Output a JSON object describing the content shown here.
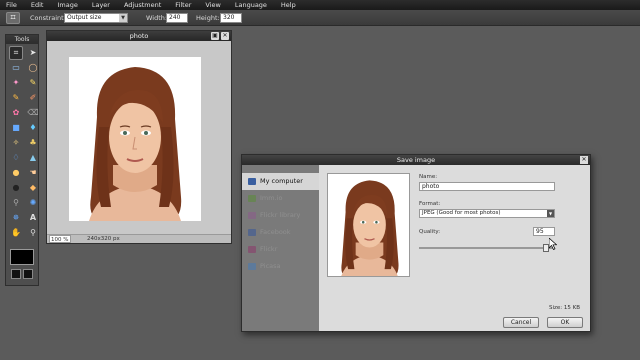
{
  "menu": [
    "File",
    "Edit",
    "Image",
    "Layer",
    "Adjustment",
    "Filter",
    "View",
    "Language",
    "Help"
  ],
  "options": {
    "constraint_label": "Constraint:",
    "constraint_value": "Output size",
    "width_label": "Width:",
    "width_value": "240",
    "height_label": "Height:",
    "height_value": "320"
  },
  "tools": {
    "title": "Tools",
    "icons": [
      "crop-icon",
      "move-icon",
      "marquee-icon",
      "lasso-icon",
      "wand-icon",
      "pencil-icon",
      "pencil2-icon",
      "brush-icon",
      "clone-icon",
      "eraser-icon",
      "gradient-icon",
      "bucket-icon",
      "replace-icon",
      "stamp-icon",
      "drop-icon",
      "sharpen-icon",
      "burn-icon",
      "smudge-icon",
      "redeye-icon",
      "sponge-icon",
      "eyedropper-icon",
      "bloat-icon",
      "pinch-icon",
      "text-icon",
      "hand-icon",
      "zoom-icon"
    ]
  },
  "photo_window": {
    "title": "photo",
    "zoom": "100 %",
    "dimensions": "240x320 px"
  },
  "save_dialog": {
    "title": "Save image",
    "destinations": [
      {
        "label": "My computer",
        "icon": "computer-icon",
        "selected": true,
        "color": "#3a5fa0"
      },
      {
        "label": "Imm.io",
        "icon": "immio-icon",
        "selected": false,
        "color": "#5c8a3c"
      },
      {
        "label": "Flickr library",
        "icon": "flickr-icon",
        "selected": false,
        "color": "#8a5c8a"
      },
      {
        "label": "Facebook",
        "icon": "facebook-icon",
        "selected": false,
        "color": "#3b5998"
      },
      {
        "label": "Flickr",
        "icon": "flickr2-icon",
        "selected": false,
        "color": "#8a3c6a"
      },
      {
        "label": "Picasa",
        "icon": "picasa-icon",
        "selected": false,
        "color": "#4a7ab0"
      }
    ],
    "name_label": "Name:",
    "name_value": "photo",
    "format_label": "Format:",
    "format_value": "JPEG (Good for most photos)",
    "quality_label": "Quality:",
    "quality_value": "95",
    "quality_fraction": 0.95,
    "size_label": "Size: 15 KB",
    "cancel_label": "Cancel",
    "ok_label": "OK"
  }
}
